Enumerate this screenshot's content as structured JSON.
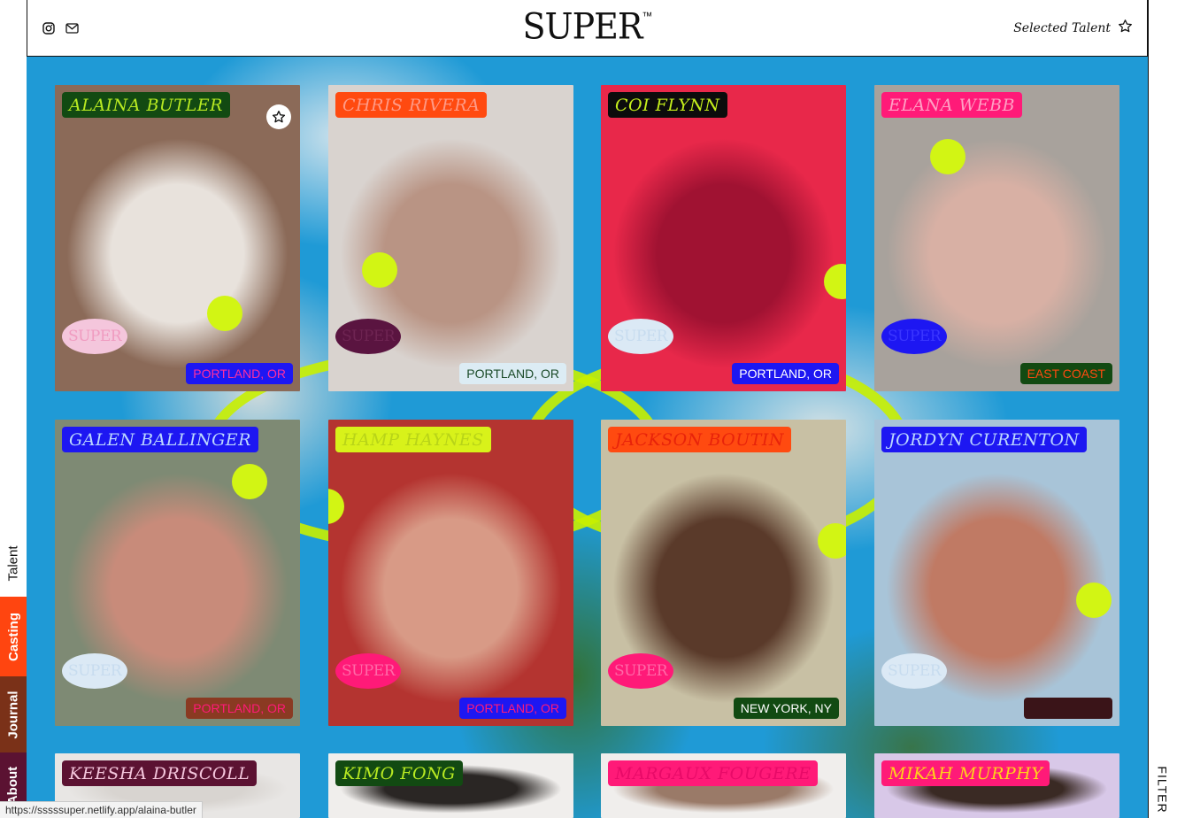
{
  "header": {
    "logo": "SUPER",
    "logo_mark": "™",
    "selected_talent_label": "Selected Talent",
    "icons": [
      "instagram-icon",
      "mail-icon",
      "star-icon"
    ]
  },
  "nav": {
    "talent": "Talent",
    "casting": "Casting",
    "journal": "Journal",
    "about": "About"
  },
  "filter_label": "FILTER",
  "status_url": "https://sssssuper.netlify.app/alaina-butler",
  "cards": [
    {
      "name": "Alaina Butler",
      "location": "PORTLAND, OR",
      "seal": "SUPER",
      "favorite_icon": "star-icon",
      "colors": {
        "name_bg": "#124a12",
        "name_fg": "#b8ea22",
        "loc_bg": "#1d17f2",
        "loc_fg": "#ff2ea0",
        "seal_bg": "#f4c6dc",
        "seal_fg": "#f09bc0",
        "photo_a": "#8b6a58",
        "photo_b": "#e8e2dc"
      }
    },
    {
      "name": "Chris Rivera",
      "location": "PORTLAND, OR",
      "seal": "SUPER",
      "colors": {
        "name_bg": "#ff4a10",
        "name_fg": "#ff9a86",
        "loc_bg": "#dcecf4",
        "loc_fg": "#1a4a28",
        "seal_bg": "#5a1440",
        "seal_fg": "#6e2452",
        "photo_a": "#d9d3cf",
        "photo_b": "#b99484"
      }
    },
    {
      "name": "Coi Flynn",
      "location": "PORTLAND, OR",
      "seal": "SUPER",
      "colors": {
        "name_bg": "#0c0c0c",
        "name_fg": "#c6f01c",
        "loc_bg": "#1d17f2",
        "loc_fg": "#ffffff",
        "seal_bg": "#dbe9f5",
        "seal_fg": "#c7dcef",
        "photo_a": "#e8284a",
        "photo_b": "#a01232"
      }
    },
    {
      "name": "Elana Webb",
      "location": "EAST COAST",
      "seal": "SUPER",
      "colors": {
        "name_bg": "#ff1a78",
        "name_fg": "#ffa0c4",
        "loc_bg": "#124a12",
        "loc_fg": "#ff4a10",
        "seal_bg": "#1d17f2",
        "seal_fg": "#3a36ff",
        "photo_a": "#a8a29c",
        "photo_b": "#d8b0a4"
      }
    },
    {
      "name": "Galen Ballinger",
      "location": "PORTLAND, OR",
      "seal": "SUPER",
      "colors": {
        "name_bg": "#1d17f2",
        "name_fg": "#bcd8ff",
        "loc_bg": "#8a3a22",
        "loc_fg": "#ff1a78",
        "seal_bg": "#dbe9f5",
        "seal_fg": "#c7dcef",
        "photo_a": "#7e8a74",
        "photo_b": "#c88b7a"
      }
    },
    {
      "name": "Hamp Haynes",
      "location": "PORTLAND, OR",
      "seal": "SUPER",
      "colors": {
        "name_bg": "#d8f21a",
        "name_fg": "#b8d418",
        "loc_bg": "#1d17f2",
        "loc_fg": "#ff1a78",
        "seal_bg": "#ff1a78",
        "seal_fg": "#ff6aa8",
        "photo_a": "#b43430",
        "photo_b": "#d89a86"
      }
    },
    {
      "name": "Jackson Boutin",
      "location": "NEW YORK, NY",
      "seal": "SUPER",
      "colors": {
        "name_bg": "#ff4a10",
        "name_fg": "#e8230a",
        "loc_bg": "#124a12",
        "loc_fg": "#ffffff",
        "seal_bg": "#ff1a78",
        "seal_fg": "#ff6aa8",
        "photo_a": "#c8c0a4",
        "photo_b": "#5a3a2a"
      }
    },
    {
      "name": "Jordyn Curenton",
      "location": "",
      "seal": "SUPER",
      "colors": {
        "name_bg": "#1d17f2",
        "name_fg": "#bcd8ff",
        "loc_bg": "#3a1418",
        "loc_fg": "#3a1418",
        "seal_bg": "#dbe9f5",
        "seal_fg": "#c7dcef",
        "photo_a": "#a8c4d8",
        "photo_b": "#c07a64"
      }
    },
    {
      "name": "Keesha Driscoll",
      "location": "",
      "seal": "",
      "colors": {
        "name_bg": "#5b1232",
        "name_fg": "#f4c6dc",
        "loc_bg": "",
        "loc_fg": "",
        "seal_bg": "",
        "seal_fg": "",
        "photo_a": "#e8e6e4",
        "photo_b": "#d8d4d0"
      }
    },
    {
      "name": "Kimo Fong",
      "location": "",
      "seal": "",
      "colors": {
        "name_bg": "#124a12",
        "name_fg": "#b8ea22",
        "loc_bg": "",
        "loc_fg": "",
        "seal_bg": "",
        "seal_fg": "",
        "photo_a": "#f0eeec",
        "photo_b": "#2a2624"
      }
    },
    {
      "name": "Margaux Fougere",
      "location": "",
      "seal": "",
      "colors": {
        "name_bg": "#ff1a78",
        "name_fg": "#e80a68",
        "loc_bg": "",
        "loc_fg": "",
        "seal_bg": "",
        "seal_fg": "",
        "photo_a": "#f0eeec",
        "photo_b": "#9a7a68"
      }
    },
    {
      "name": "Mikah Murphy",
      "location": "",
      "seal": "",
      "colors": {
        "name_bg": "#ff1a78",
        "name_fg": "#ffd21a",
        "loc_bg": "",
        "loc_fg": "",
        "seal_bg": "",
        "seal_fg": "",
        "photo_a": "#d8c8e8",
        "photo_b": "#3a2a24"
      }
    }
  ]
}
